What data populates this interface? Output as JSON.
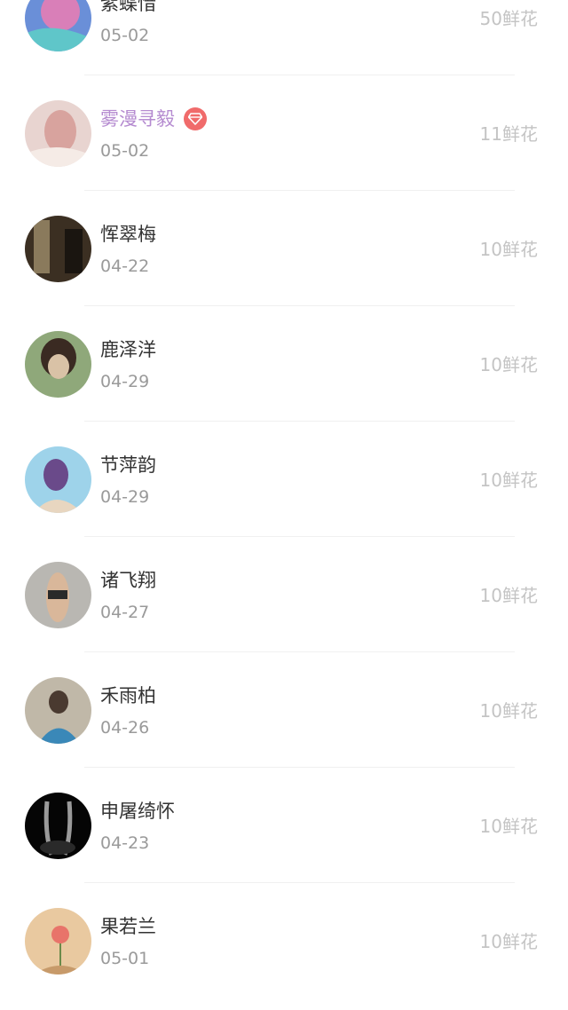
{
  "rows": [
    {
      "name": "紫蝶惜",
      "date": "05-02",
      "flowers": "50鲜花",
      "vip": false,
      "avatar_colors": [
        "#6a8fd8",
        "#d97fb8",
        "#5fc6c9"
      ]
    },
    {
      "name": "雾漫寻毅",
      "date": "05-02",
      "flowers": "11鲜花",
      "vip": true,
      "avatar_colors": [
        "#e8d4d0",
        "#d8a39e",
        "#f5ebe6"
      ]
    },
    {
      "name": "恽翠梅",
      "date": "04-22",
      "flowers": "10鲜花",
      "vip": false,
      "avatar_colors": [
        "#3b2f22",
        "#8a7a5c",
        "#1a1510"
      ]
    },
    {
      "name": "鹿泽洋",
      "date": "04-29",
      "flowers": "10鲜花",
      "vip": false,
      "avatar_colors": [
        "#8fa87a",
        "#3a2a22",
        "#d9c2a6"
      ]
    },
    {
      "name": "节萍韵",
      "date": "04-29",
      "flowers": "10鲜花",
      "vip": false,
      "avatar_colors": [
        "#9ed3ea",
        "#6a4a8a",
        "#e8d6c0"
      ]
    },
    {
      "name": "诸飞翔",
      "date": "04-27",
      "flowers": "10鲜花",
      "vip": false,
      "avatar_colors": [
        "#b9b7b2",
        "#2a2a2a",
        "#d9b79a"
      ]
    },
    {
      "name": "禾雨柏",
      "date": "04-26",
      "flowers": "10鲜花",
      "vip": false,
      "avatar_colors": [
        "#c0b8a8",
        "#3a88b8",
        "#4a3a30"
      ]
    },
    {
      "name": "申屠绮怀",
      "date": "04-23",
      "flowers": "10鲜花",
      "vip": false,
      "avatar_colors": [
        "#050505",
        "#9a9a9a",
        "#2a2a2a"
      ]
    },
    {
      "name": "果若兰",
      "date": "05-01",
      "flowers": "10鲜花",
      "vip": false,
      "avatar_colors": [
        "#e9c9a0",
        "#e8746a",
        "#c79a6a"
      ]
    }
  ],
  "colors": {
    "vip_name": "#b58bd0",
    "vip_badge": "#f06b6b",
    "name": "#333333",
    "date": "#9a9a9a",
    "flowers": "#c4c4c4"
  }
}
